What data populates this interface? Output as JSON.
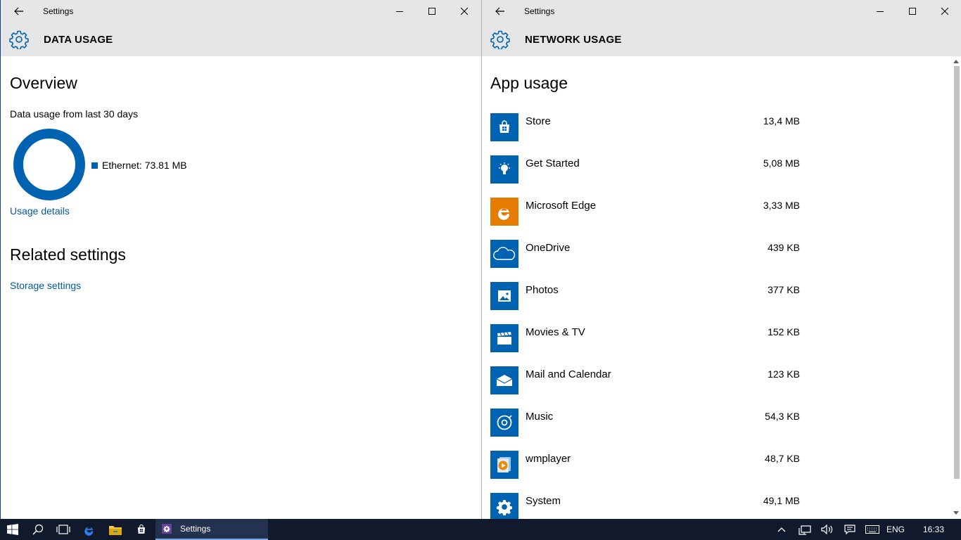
{
  "left_window": {
    "title": "Settings",
    "header": "DATA USAGE",
    "overview_heading": "Overview",
    "subtitle": "Data usage from last 30 days",
    "legend_label": "Ethernet: 73.81 MB",
    "usage_details_link": "Usage details",
    "related_heading": "Related settings",
    "storage_link": "Storage settings"
  },
  "right_window": {
    "title": "Settings",
    "header": "NETWORK USAGE",
    "heading": "App usage",
    "apps": [
      {
        "name": "Store",
        "size": "13,4 MB",
        "icon": "store-icon",
        "color": "#0063b1"
      },
      {
        "name": "Get Started",
        "size": "5,08 MB",
        "icon": "lightbulb-icon",
        "color": "#0063b1"
      },
      {
        "name": "Microsoft Edge",
        "size": "3,33 MB",
        "icon": "edge-icon",
        "color": "#e57c00"
      },
      {
        "name": "OneDrive",
        "size": "439 KB",
        "icon": "cloud-icon",
        "color": "#0063b1"
      },
      {
        "name": "Photos",
        "size": "377 KB",
        "icon": "photo-icon",
        "color": "#0063b1"
      },
      {
        "name": "Movies & TV",
        "size": "152 KB",
        "icon": "clapper-icon",
        "color": "#0063b1"
      },
      {
        "name": "Mail and Calendar",
        "size": "123 KB",
        "icon": "mail-icon",
        "color": "#0063b1"
      },
      {
        "name": "Music",
        "size": "54,3 KB",
        "icon": "music-icon",
        "color": "#0063b1"
      },
      {
        "name": "wmplayer",
        "size": "48,7 KB",
        "icon": "wmplayer-icon",
        "color": "#0063b1"
      },
      {
        "name": "System",
        "size": "49,1 MB",
        "icon": "gear-icon",
        "color": "#0063b1"
      }
    ]
  },
  "taskbar": {
    "active_app_label": "Settings",
    "language": "ENG",
    "clock": "16:33"
  },
  "colors": {
    "accent": "#0063b1",
    "link": "#005a9e",
    "titlebar": "#e6e6e6",
    "taskbar": "#101a2c"
  }
}
